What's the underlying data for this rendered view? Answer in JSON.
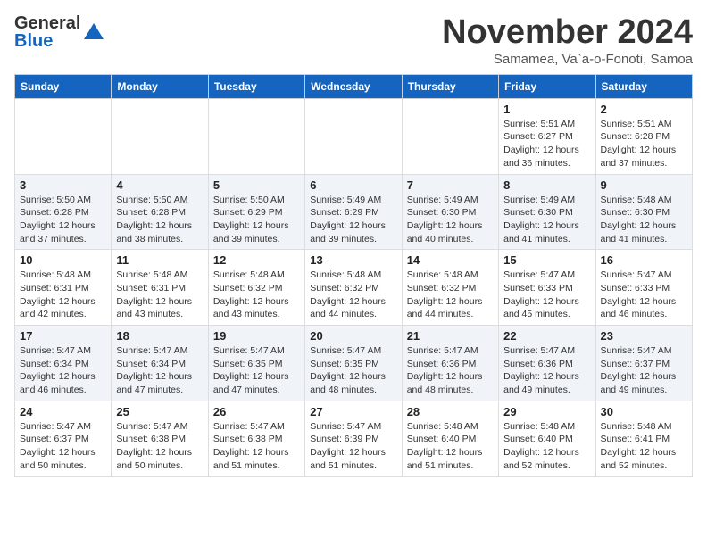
{
  "header": {
    "logo_general": "General",
    "logo_blue": "Blue",
    "month_title": "November 2024",
    "location": "Samamea, Va`a-o-Fonoti, Samoa"
  },
  "weekdays": [
    "Sunday",
    "Monday",
    "Tuesday",
    "Wednesday",
    "Thursday",
    "Friday",
    "Saturday"
  ],
  "weeks": [
    [
      {
        "day": "",
        "info": ""
      },
      {
        "day": "",
        "info": ""
      },
      {
        "day": "",
        "info": ""
      },
      {
        "day": "",
        "info": ""
      },
      {
        "day": "",
        "info": ""
      },
      {
        "day": "1",
        "info": "Sunrise: 5:51 AM\nSunset: 6:27 PM\nDaylight: 12 hours and 36 minutes."
      },
      {
        "day": "2",
        "info": "Sunrise: 5:51 AM\nSunset: 6:28 PM\nDaylight: 12 hours and 37 minutes."
      }
    ],
    [
      {
        "day": "3",
        "info": "Sunrise: 5:50 AM\nSunset: 6:28 PM\nDaylight: 12 hours and 37 minutes."
      },
      {
        "day": "4",
        "info": "Sunrise: 5:50 AM\nSunset: 6:28 PM\nDaylight: 12 hours and 38 minutes."
      },
      {
        "day": "5",
        "info": "Sunrise: 5:50 AM\nSunset: 6:29 PM\nDaylight: 12 hours and 39 minutes."
      },
      {
        "day": "6",
        "info": "Sunrise: 5:49 AM\nSunset: 6:29 PM\nDaylight: 12 hours and 39 minutes."
      },
      {
        "day": "7",
        "info": "Sunrise: 5:49 AM\nSunset: 6:30 PM\nDaylight: 12 hours and 40 minutes."
      },
      {
        "day": "8",
        "info": "Sunrise: 5:49 AM\nSunset: 6:30 PM\nDaylight: 12 hours and 41 minutes."
      },
      {
        "day": "9",
        "info": "Sunrise: 5:48 AM\nSunset: 6:30 PM\nDaylight: 12 hours and 41 minutes."
      }
    ],
    [
      {
        "day": "10",
        "info": "Sunrise: 5:48 AM\nSunset: 6:31 PM\nDaylight: 12 hours and 42 minutes."
      },
      {
        "day": "11",
        "info": "Sunrise: 5:48 AM\nSunset: 6:31 PM\nDaylight: 12 hours and 43 minutes."
      },
      {
        "day": "12",
        "info": "Sunrise: 5:48 AM\nSunset: 6:32 PM\nDaylight: 12 hours and 43 minutes."
      },
      {
        "day": "13",
        "info": "Sunrise: 5:48 AM\nSunset: 6:32 PM\nDaylight: 12 hours and 44 minutes."
      },
      {
        "day": "14",
        "info": "Sunrise: 5:48 AM\nSunset: 6:32 PM\nDaylight: 12 hours and 44 minutes."
      },
      {
        "day": "15",
        "info": "Sunrise: 5:47 AM\nSunset: 6:33 PM\nDaylight: 12 hours and 45 minutes."
      },
      {
        "day": "16",
        "info": "Sunrise: 5:47 AM\nSunset: 6:33 PM\nDaylight: 12 hours and 46 minutes."
      }
    ],
    [
      {
        "day": "17",
        "info": "Sunrise: 5:47 AM\nSunset: 6:34 PM\nDaylight: 12 hours and 46 minutes."
      },
      {
        "day": "18",
        "info": "Sunrise: 5:47 AM\nSunset: 6:34 PM\nDaylight: 12 hours and 47 minutes."
      },
      {
        "day": "19",
        "info": "Sunrise: 5:47 AM\nSunset: 6:35 PM\nDaylight: 12 hours and 47 minutes."
      },
      {
        "day": "20",
        "info": "Sunrise: 5:47 AM\nSunset: 6:35 PM\nDaylight: 12 hours and 48 minutes."
      },
      {
        "day": "21",
        "info": "Sunrise: 5:47 AM\nSunset: 6:36 PM\nDaylight: 12 hours and 48 minutes."
      },
      {
        "day": "22",
        "info": "Sunrise: 5:47 AM\nSunset: 6:36 PM\nDaylight: 12 hours and 49 minutes."
      },
      {
        "day": "23",
        "info": "Sunrise: 5:47 AM\nSunset: 6:37 PM\nDaylight: 12 hours and 49 minutes."
      }
    ],
    [
      {
        "day": "24",
        "info": "Sunrise: 5:47 AM\nSunset: 6:37 PM\nDaylight: 12 hours and 50 minutes."
      },
      {
        "day": "25",
        "info": "Sunrise: 5:47 AM\nSunset: 6:38 PM\nDaylight: 12 hours and 50 minutes."
      },
      {
        "day": "26",
        "info": "Sunrise: 5:47 AM\nSunset: 6:38 PM\nDaylight: 12 hours and 51 minutes."
      },
      {
        "day": "27",
        "info": "Sunrise: 5:47 AM\nSunset: 6:39 PM\nDaylight: 12 hours and 51 minutes."
      },
      {
        "day": "28",
        "info": "Sunrise: 5:48 AM\nSunset: 6:40 PM\nDaylight: 12 hours and 51 minutes."
      },
      {
        "day": "29",
        "info": "Sunrise: 5:48 AM\nSunset: 6:40 PM\nDaylight: 12 hours and 52 minutes."
      },
      {
        "day": "30",
        "info": "Sunrise: 5:48 AM\nSunset: 6:41 PM\nDaylight: 12 hours and 52 minutes."
      }
    ]
  ]
}
